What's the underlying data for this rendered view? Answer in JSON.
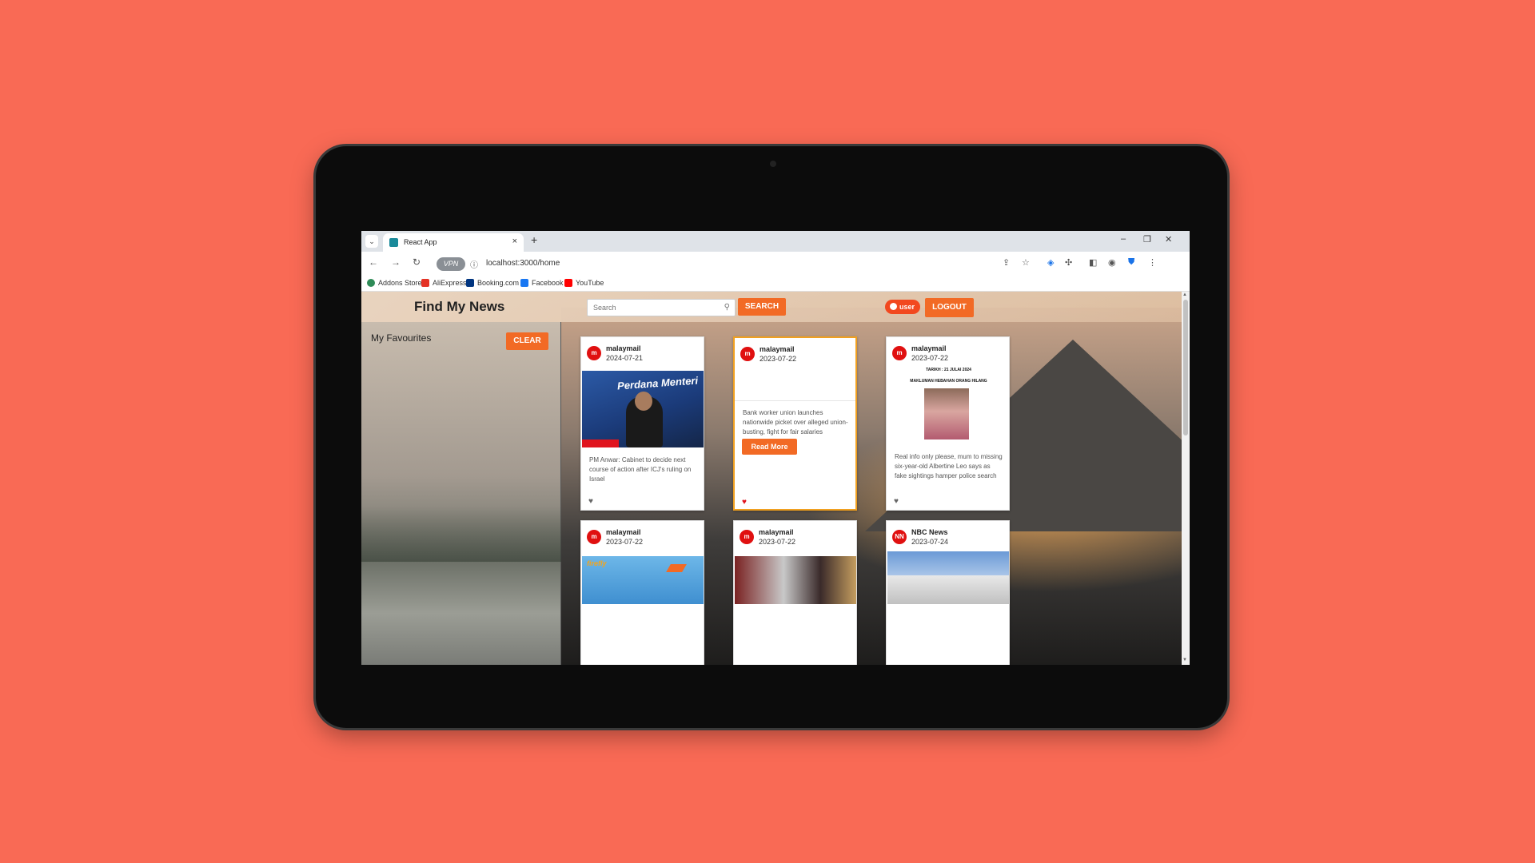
{
  "browser": {
    "tab_title": "React App",
    "tab_close": "×",
    "new_tab": "+",
    "tab_dropdown": "⌄",
    "url": "localhost:3000/home",
    "vpn_label": "VPN",
    "nav_back": "←",
    "nav_forward": "→",
    "nav_reload": "↻",
    "window_minimize": "–",
    "window_restore": "❐",
    "window_close": "✕",
    "bookmarks": [
      {
        "label": "Addons Store",
        "color": "#2e8b57"
      },
      {
        "label": "AliExpress",
        "color": "#e43225"
      },
      {
        "label": "Booking.com",
        "color": "#003580"
      },
      {
        "label": "Facebook",
        "color": "#1877f2"
      },
      {
        "label": "YouTube",
        "color": "#ff0000"
      }
    ]
  },
  "header": {
    "brand": "Find My News",
    "search_placeholder": "Search",
    "search_button": "SEARCH",
    "user_label": "user",
    "logout_button": "LOGOUT"
  },
  "sidebar": {
    "title": "My Favourites",
    "clear_button": "CLEAR"
  },
  "cards": [
    {
      "avatar": "m",
      "source": "malaymail",
      "date": "2024-07-21",
      "text": "PM Anwar: Cabinet to decide next course of action after ICJ's ruling on Israel",
      "image_text": "Perdana Menteri",
      "liked": false
    },
    {
      "avatar": "m",
      "source": "malaymail",
      "date": "2023-07-22",
      "text": "Bank worker union launches nationwide picket over alleged union-busting, fight for fair salaries",
      "read_more": "Read More",
      "liked": true
    },
    {
      "avatar": "m",
      "source": "malaymail",
      "date": "2023-07-22",
      "text": "Real info only please, mum to missing six-year-old Albertine Leo says as fake sightings hamper police search",
      "image_line1": "TARIKH : 21 JULAI 2024",
      "image_line2": "MAKLUMAN HEBAHAN ORANG HILANG",
      "liked": false
    },
    {
      "avatar": "m",
      "source": "malaymail",
      "date": "2023-07-22",
      "image_text": "firefly"
    },
    {
      "avatar": "m",
      "source": "malaymail",
      "date": "2023-07-22"
    },
    {
      "avatar": "NN",
      "source": "NBC News",
      "date": "2023-07-24"
    }
  ],
  "icons": {
    "heart": "♥",
    "search": "⚲"
  }
}
